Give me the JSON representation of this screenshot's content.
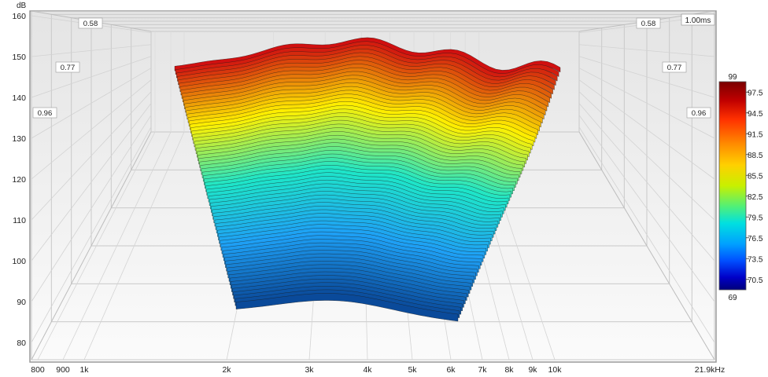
{
  "chart_data": {
    "type": "waterfall-3d",
    "y_unit": "dB",
    "x_unit_label": "21.9kHz",
    "time_label": "1.00ms",
    "y_ticks": [
      "160",
      "150",
      "140",
      "130",
      "120",
      "110",
      "100",
      "90",
      "80"
    ],
    "x_ticks": [
      "800",
      "900",
      "1k",
      "2k",
      "3k",
      "4k",
      "5k",
      "6k",
      "7k",
      "8k",
      "9k",
      "10k"
    ],
    "depth_labels": [
      "0.58",
      "0.77",
      "0.96"
    ],
    "colorbar": {
      "max": "99",
      "min": "69",
      "ticks": [
        "97.5",
        "94.5",
        "91.5",
        "88.5",
        "85.5",
        "82.5",
        "79.5",
        "76.5",
        "73.5",
        "70.5"
      ],
      "colors": [
        "#7a0000",
        "#c00000",
        "#ff3000",
        "#ff8c00",
        "#ffd000",
        "#c8f000",
        "#50f078",
        "#00e0e0",
        "#00a0ff",
        "#0050ff",
        "#0000c8",
        "#00007a"
      ]
    },
    "slice_count": 70,
    "surface_colors": {
      "front": "#0a4a9a",
      "low": "#1ea0f5",
      "mid": "#1ee6c8",
      "high": "#fff000",
      "peak": "#d01010"
    }
  }
}
